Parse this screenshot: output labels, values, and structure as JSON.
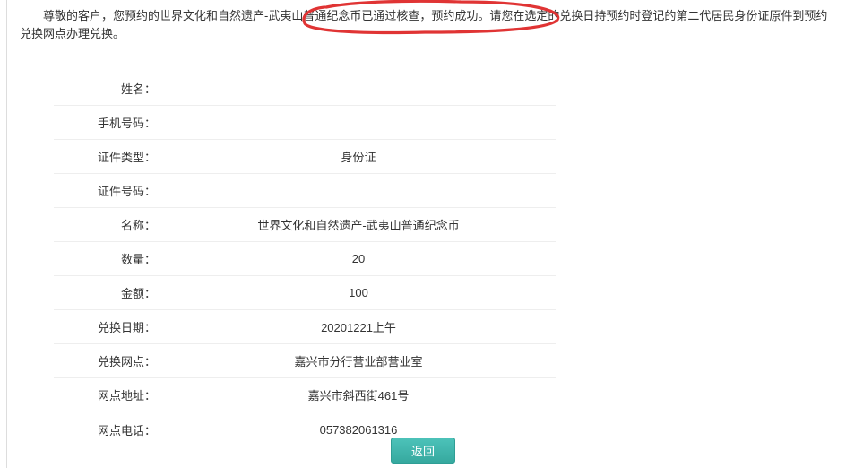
{
  "notice": {
    "prefix": "尊敬的客户，您预约的世界文化和自然遗产",
    "highlight": "-武夷山普通纪念币已通过核查，预约成功。",
    "suffix": "请您在选定的兑换日持预约时登记的第二代居民身份证原件到预约兑换网点办理兑换。"
  },
  "fields": [
    {
      "label": "姓名：",
      "value": ""
    },
    {
      "label": "手机号码：",
      "value": ""
    },
    {
      "label": "证件类型：",
      "value": "身份证"
    },
    {
      "label": "证件号码：",
      "value": ""
    },
    {
      "label": "名称：",
      "value": "世界文化和自然遗产-武夷山普通纪念币"
    },
    {
      "label": "数量：",
      "value": "20"
    },
    {
      "label": "金额：",
      "value": "100"
    },
    {
      "label": "兑换日期：",
      "value": "20201221上午"
    },
    {
      "label": "兑换网点：",
      "value": "嘉兴市分行营业部营业室"
    },
    {
      "label": "网点地址：",
      "value": "嘉兴市斜西街461号"
    },
    {
      "label": "网点电话：",
      "value": "057382061316"
    }
  ],
  "buttons": {
    "back": "返回"
  },
  "colors": {
    "accent": "#3fb8af",
    "annotation": "#e03434"
  }
}
